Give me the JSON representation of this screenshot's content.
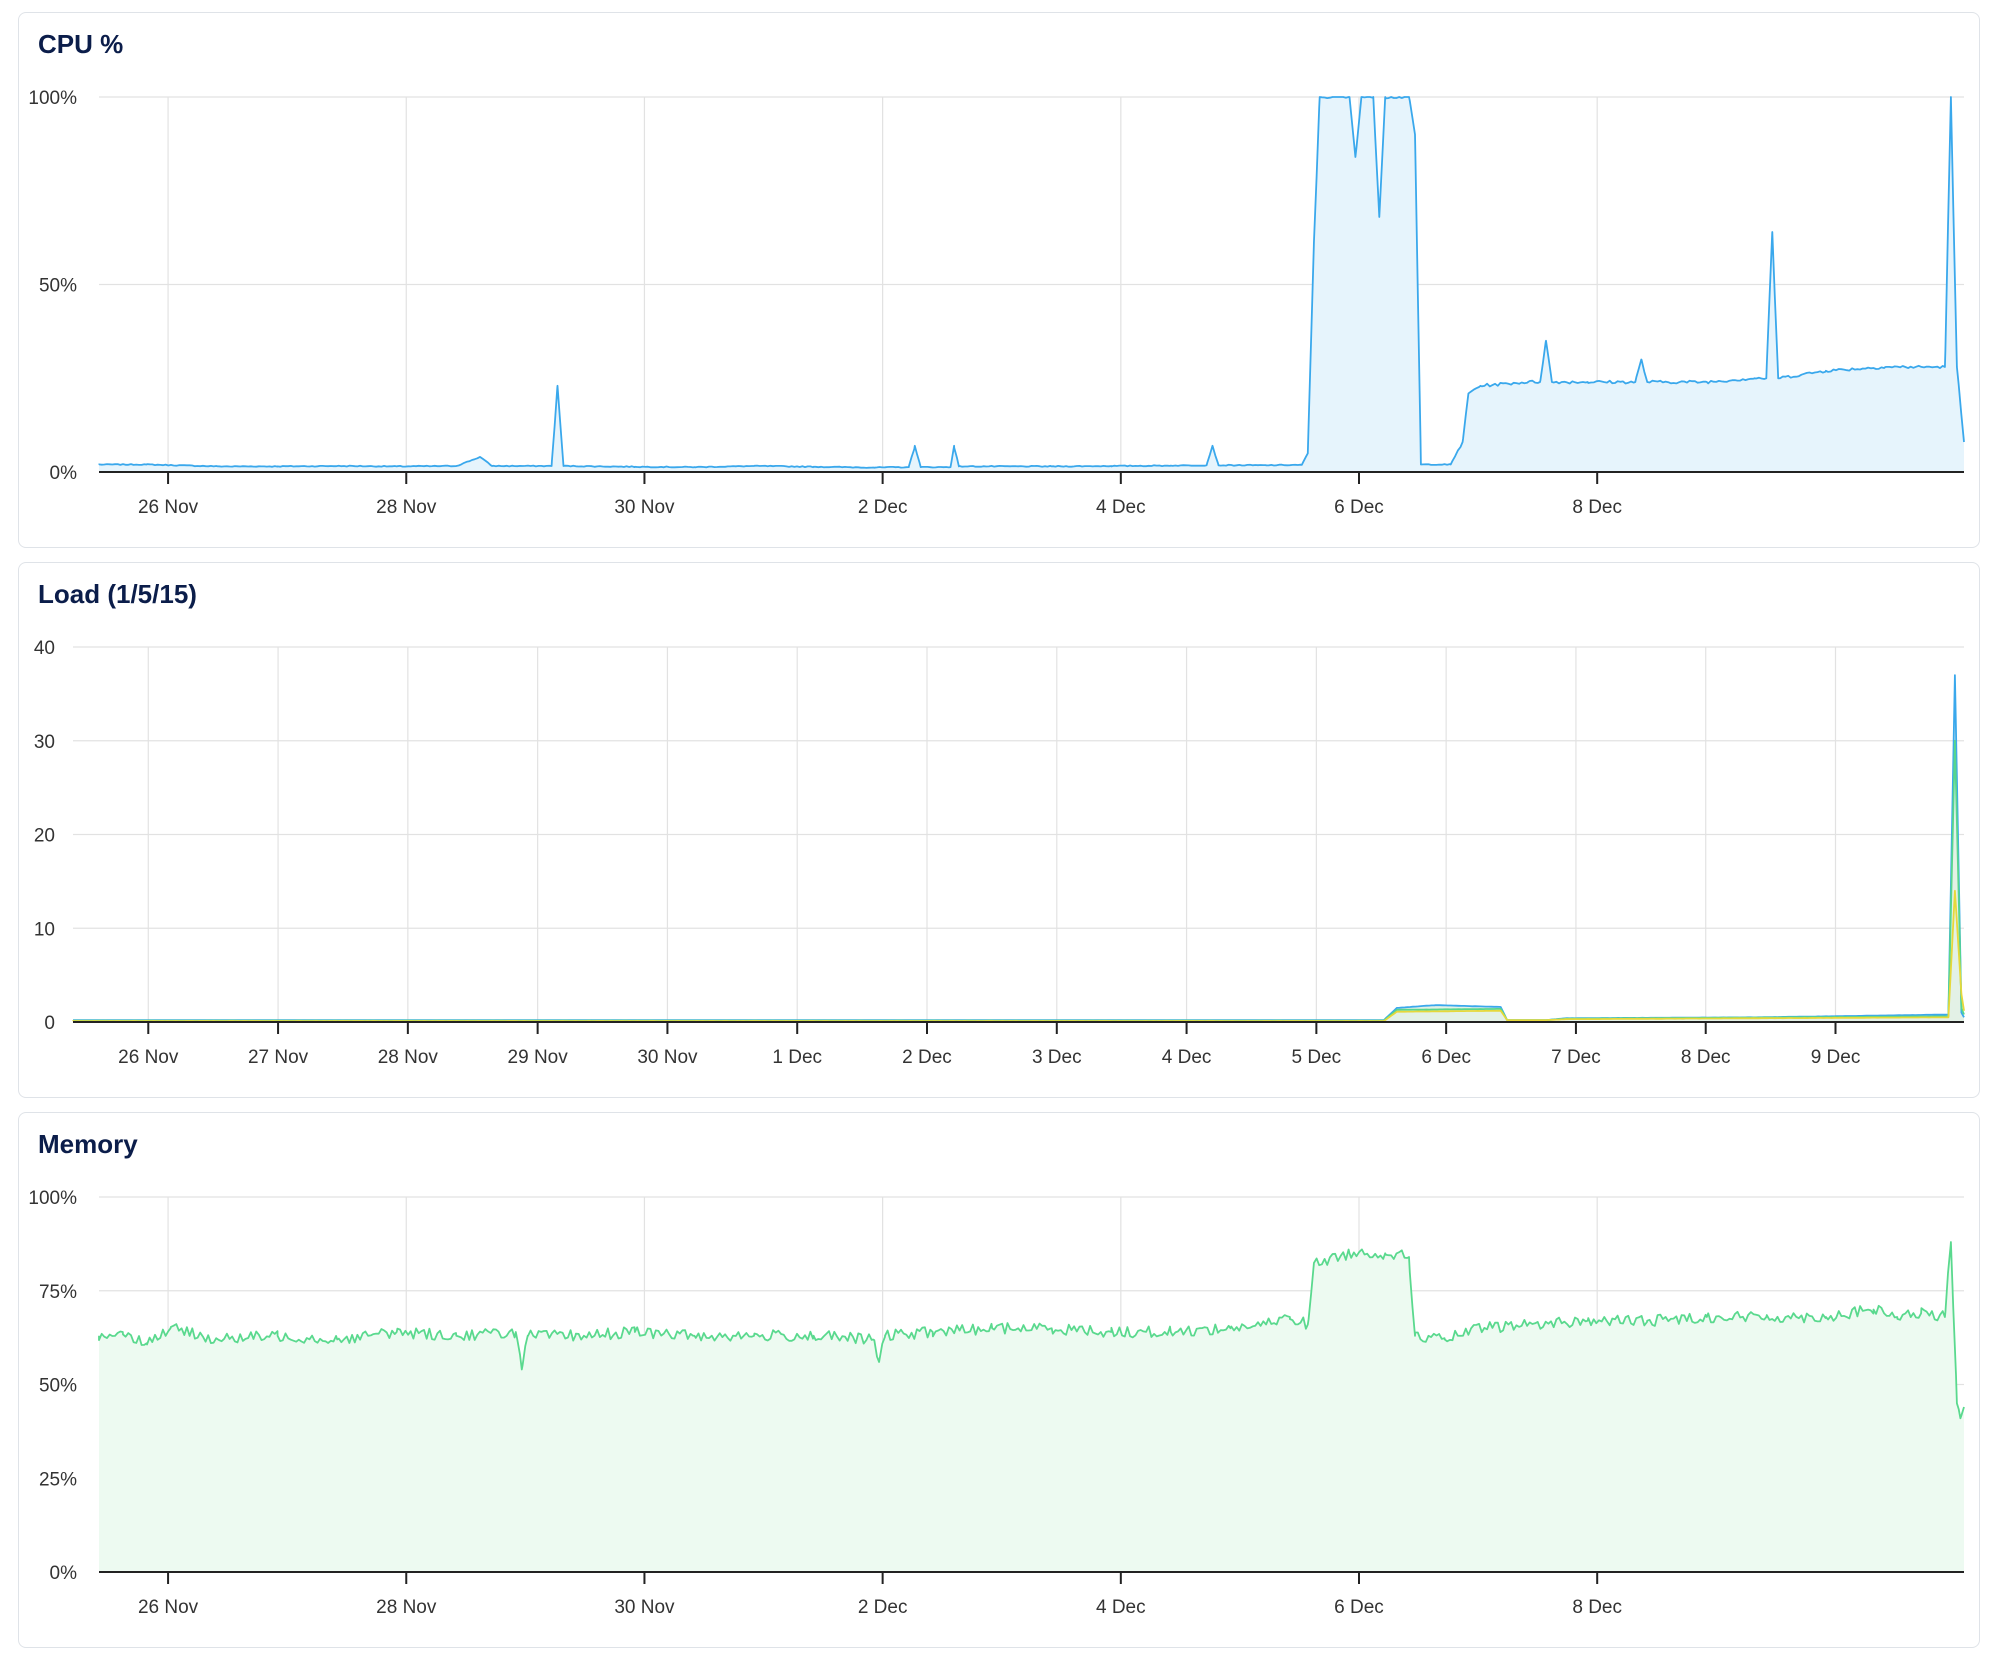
{
  "colors": {
    "cpu": "#3aa8ec",
    "cpu_fill": "#e6f4fc",
    "load_1": "#3aa8ec",
    "load_5": "#57d68d",
    "load_15": "#e6d83a",
    "load_fill": "#e3f1e6",
    "memory": "#5ad98e",
    "memory_fill": "#edfaf1",
    "grid": "#e2e2e2",
    "axis": "#222222",
    "title": "#0b1d4a"
  },
  "chart_data": [
    {
      "id": "cpu",
      "type": "area",
      "title": "CPU %",
      "xlabel": "",
      "ylabel": "",
      "x_range": [
        "2024-11-25T14:00",
        "2024-12-09T14:00"
      ],
      "x_ticks": [
        "26 Nov",
        "28 Nov",
        "30 Nov",
        "2 Dec",
        "4 Dec",
        "6 Dec",
        "8 Dec"
      ],
      "x_tick_days": [
        1,
        3,
        5,
        7,
        9,
        11,
        13
      ],
      "y_ticks": [
        "0%",
        "50%",
        "100%"
      ],
      "y_tick_values": [
        0,
        50,
        100
      ],
      "ylim": [
        0,
        100
      ],
      "grid": true,
      "legend": "none",
      "series": [
        {
          "points": [
            [
              0.0,
              2
            ],
            [
              0.4,
              2
            ],
            [
              1.0,
              1.5
            ],
            [
              1.5,
              1.5
            ],
            [
              2.0,
              1.6
            ],
            [
              2.5,
              1.5
            ],
            [
              3.0,
              1.6
            ],
            [
              3.2,
              4
            ],
            [
              3.3,
              1.6
            ],
            [
              3.8,
              1.6
            ],
            [
              3.85,
              23
            ],
            [
              3.9,
              1.6
            ],
            [
              4.5,
              1.4
            ],
            [
              5.0,
              1.3
            ],
            [
              5.5,
              1.6
            ],
            [
              6.0,
              1.4
            ],
            [
              6.5,
              1.2
            ],
            [
              6.8,
              1.3
            ],
            [
              6.85,
              7
            ],
            [
              6.9,
              1.3
            ],
            [
              7.15,
              1.3
            ],
            [
              7.18,
              7
            ],
            [
              7.22,
              1.5
            ],
            [
              8.0,
              1.5
            ],
            [
              8.5,
              1.6
            ],
            [
              9.0,
              1.7
            ],
            [
              9.3,
              1.8
            ],
            [
              9.35,
              7
            ],
            [
              9.4,
              1.8
            ],
            [
              9.8,
              1.8
            ],
            [
              10.1,
              1.9
            ],
            [
              10.15,
              5
            ],
            [
              10.2,
              60
            ],
            [
              10.25,
              100
            ],
            [
              10.5,
              100
            ],
            [
              10.55,
              84
            ],
            [
              10.6,
              100
            ],
            [
              10.7,
              100
            ],
            [
              10.75,
              68
            ],
            [
              10.8,
              100
            ],
            [
              11.0,
              100
            ],
            [
              11.05,
              90
            ],
            [
              11.1,
              2
            ],
            [
              11.35,
              2
            ],
            [
              11.45,
              8
            ],
            [
              11.5,
              21
            ],
            [
              11.6,
              23
            ],
            [
              12.0,
              24
            ],
            [
              12.1,
              24
            ],
            [
              12.15,
              35
            ],
            [
              12.2,
              24
            ],
            [
              12.5,
              24
            ],
            [
              12.9,
              24
            ],
            [
              12.95,
              30
            ],
            [
              13.0,
              24
            ],
            [
              13.5,
              24
            ],
            [
              13.9,
              25
            ],
            [
              14.0,
              25
            ],
            [
              14.05,
              64
            ],
            [
              14.1,
              25
            ],
            [
              14.5,
              27
            ],
            [
              15.0,
              28
            ],
            [
              15.5,
              28
            ],
            [
              15.55,
              100
            ],
            [
              15.6,
              28
            ],
            [
              15.66,
              8
            ]
          ]
        }
      ]
    },
    {
      "id": "load",
      "type": "line",
      "title": "Load (1/5/15)",
      "xlabel": "",
      "ylabel": "",
      "x_range": [
        "2024-11-25T14:00",
        "2024-12-09T14:00"
      ],
      "x_ticks": [
        "26 Nov",
        "27 Nov",
        "28 Nov",
        "29 Nov",
        "30 Nov",
        "1 Dec",
        "2 Dec",
        "3 Dec",
        "4 Dec",
        "5 Dec",
        "6 Dec",
        "7 Dec",
        "8 Dec",
        "9 Dec"
      ],
      "x_tick_days": [
        1,
        2,
        3,
        4,
        5,
        6,
        7,
        8,
        9,
        10,
        11,
        12,
        13,
        14
      ],
      "y_ticks": [
        "0",
        "10",
        "20",
        "30",
        "40"
      ],
      "y_tick_values": [
        0,
        10,
        20,
        30,
        40
      ],
      "ylim": [
        0,
        40
      ],
      "grid": true,
      "legend": "none",
      "series": [
        {
          "points": [
            [
              0,
              0.2
            ],
            [
              4.0,
              0.2
            ],
            [
              9.8,
              0.2
            ],
            [
              10.1,
              0.2
            ],
            [
              10.2,
              1.5
            ],
            [
              10.5,
              1.8
            ],
            [
              11.0,
              1.6
            ],
            [
              11.05,
              0.2
            ],
            [
              11.35,
              0.2
            ],
            [
              11.5,
              0.4
            ],
            [
              13.0,
              0.5
            ],
            [
              14.0,
              0.7
            ],
            [
              14.45,
              0.8
            ],
            [
              14.5,
              37
            ],
            [
              14.55,
              1.0
            ],
            [
              14.57,
              0.5
            ]
          ]
        },
        {
          "points": [
            [
              0,
              0.15
            ],
            [
              10.1,
              0.15
            ],
            [
              10.2,
              1.3
            ],
            [
              11.0,
              1.4
            ],
            [
              11.05,
              0.2
            ],
            [
              11.35,
              0.2
            ],
            [
              11.5,
              0.35
            ],
            [
              14.45,
              0.6
            ],
            [
              14.5,
              30
            ],
            [
              14.55,
              1.5
            ],
            [
              14.57,
              0.8
            ]
          ]
        },
        {
          "points": [
            [
              0,
              0.1
            ],
            [
              10.1,
              0.1
            ],
            [
              10.2,
              1.1
            ],
            [
              11.0,
              1.2
            ],
            [
              11.05,
              0.2
            ],
            [
              11.35,
              0.2
            ],
            [
              11.5,
              0.3
            ],
            [
              14.45,
              0.5
            ],
            [
              14.5,
              14
            ],
            [
              14.55,
              3
            ],
            [
              14.57,
              1.2
            ]
          ]
        }
      ]
    },
    {
      "id": "memory",
      "type": "area",
      "title": "Memory",
      "xlabel": "",
      "ylabel": "",
      "x_range": [
        "2024-11-25T14:00",
        "2024-12-09T14:00"
      ],
      "x_ticks": [
        "26 Nov",
        "28 Nov",
        "30 Nov",
        "2 Dec",
        "4 Dec",
        "6 Dec",
        "8 Dec"
      ],
      "x_tick_days": [
        1,
        3,
        5,
        7,
        9,
        11,
        13
      ],
      "y_ticks": [
        "0%",
        "25%",
        "50%",
        "75%",
        "100%"
      ],
      "y_tick_values": [
        0,
        25,
        50,
        75,
        100
      ],
      "ylim": [
        0,
        100
      ],
      "grid": true,
      "legend": "none",
      "series": [
        {
          "points": [
            [
              0.0,
              63
            ],
            [
              0.2,
              64
            ],
            [
              0.4,
              61
            ],
            [
              0.6,
              65
            ],
            [
              1.0,
              62
            ],
            [
              1.5,
              63
            ],
            [
              2.0,
              62
            ],
            [
              2.5,
              64
            ],
            [
              3.0,
              63
            ],
            [
              3.5,
              64
            ],
            [
              3.55,
              54
            ],
            [
              3.6,
              63
            ],
            [
              4.0,
              63
            ],
            [
              4.5,
              64
            ],
            [
              5.0,
              63
            ],
            [
              5.5,
              63
            ],
            [
              6.0,
              63
            ],
            [
              6.5,
              62
            ],
            [
              6.55,
              56
            ],
            [
              6.6,
              63
            ],
            [
              7.0,
              64
            ],
            [
              7.5,
              65
            ],
            [
              8.0,
              65
            ],
            [
              8.5,
              64
            ],
            [
              9.0,
              64
            ],
            [
              9.5,
              65
            ],
            [
              9.8,
              66
            ],
            [
              10.0,
              68
            ],
            [
              10.15,
              66
            ],
            [
              10.2,
              82
            ],
            [
              10.5,
              85
            ],
            [
              10.8,
              85
            ],
            [
              11.0,
              84
            ],
            [
              11.05,
              63
            ],
            [
              11.3,
              62
            ],
            [
              11.6,
              65
            ],
            [
              12.0,
              66
            ],
            [
              12.5,
              67
            ],
            [
              13.0,
              67
            ],
            [
              13.5,
              68
            ],
            [
              14.0,
              68
            ],
            [
              14.5,
              68
            ],
            [
              14.9,
              70
            ],
            [
              15.1,
              68
            ],
            [
              15.3,
              69
            ],
            [
              15.5,
              68
            ],
            [
              15.55,
              88
            ],
            [
              15.6,
              45
            ],
            [
              15.63,
              41
            ],
            [
              15.66,
              44
            ]
          ]
        }
      ]
    }
  ]
}
